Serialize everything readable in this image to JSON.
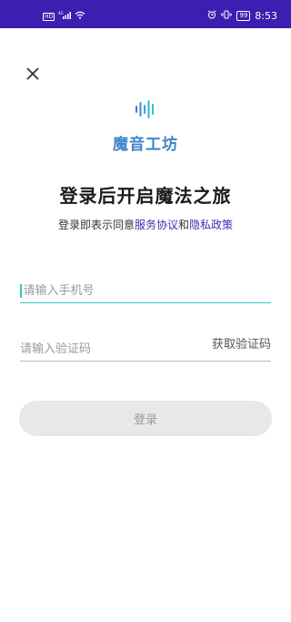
{
  "status_bar": {
    "hd_label": "HD",
    "signal_label": "4G",
    "battery": "99",
    "time": "8:53"
  },
  "brand": {
    "name": "魔音工坊",
    "color": "#3f84c8"
  },
  "headline": "登录后开启魔法之旅",
  "agreement": {
    "prefix": "登录即表示同意",
    "service_link": "服务协议",
    "conjunction": "和",
    "privacy_link": "隐私政策"
  },
  "phone_field": {
    "placeholder": "请输入手机号",
    "value": ""
  },
  "code_field": {
    "placeholder": "请输入验证码",
    "value": "",
    "get_code_label": "获取验证码"
  },
  "login_button": {
    "label": "登录"
  },
  "colors": {
    "status_bar": "#3b1fb0",
    "accent_teal": "#35c6c2",
    "link": "#3b2fb0",
    "button_disabled": "#e8e8e8"
  },
  "icons": {
    "close": "close-icon",
    "logo": "sound-wave-logo-icon"
  }
}
